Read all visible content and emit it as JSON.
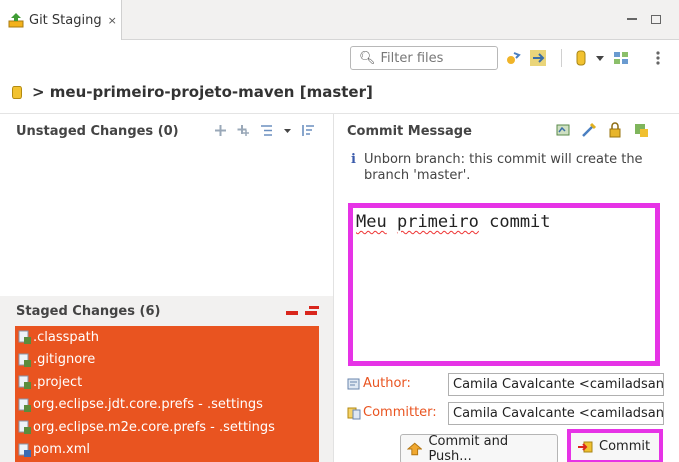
{
  "view": {
    "tab_title": "Git Staging",
    "tab_close": "×"
  },
  "toolbar": {
    "filter_placeholder": "Filter files"
  },
  "repository": {
    "title": "> meu-primeiro-projeto-maven [master]"
  },
  "unstaged": {
    "header": "Unstaged Changes (0)"
  },
  "staged": {
    "header": "Staged Changes (6)",
    "files": [
      ".classpath",
      ".gitignore",
      ".project",
      "org.eclipse.jdt.core.prefs - .settings",
      "org.eclipse.m2e.core.prefs - .settings",
      "pom.xml"
    ]
  },
  "commit": {
    "header": "Commit Message",
    "info": "Unborn branch: this commit will create the branch 'master'.",
    "message_word1": "Meu",
    "message_word2": "primeiro",
    "message_word3": "commit",
    "author_label": "Author:",
    "author_value": "Camila Cavalcante <camiladsan",
    "committer_label": "Committer:",
    "committer_value": "Camila Cavalcante <camiladsan",
    "commit_and_push_label": "Commit and Push...",
    "commit_label": "Commit"
  },
  "colors": {
    "accent": "#e95420",
    "highlight": "#e633e6"
  }
}
